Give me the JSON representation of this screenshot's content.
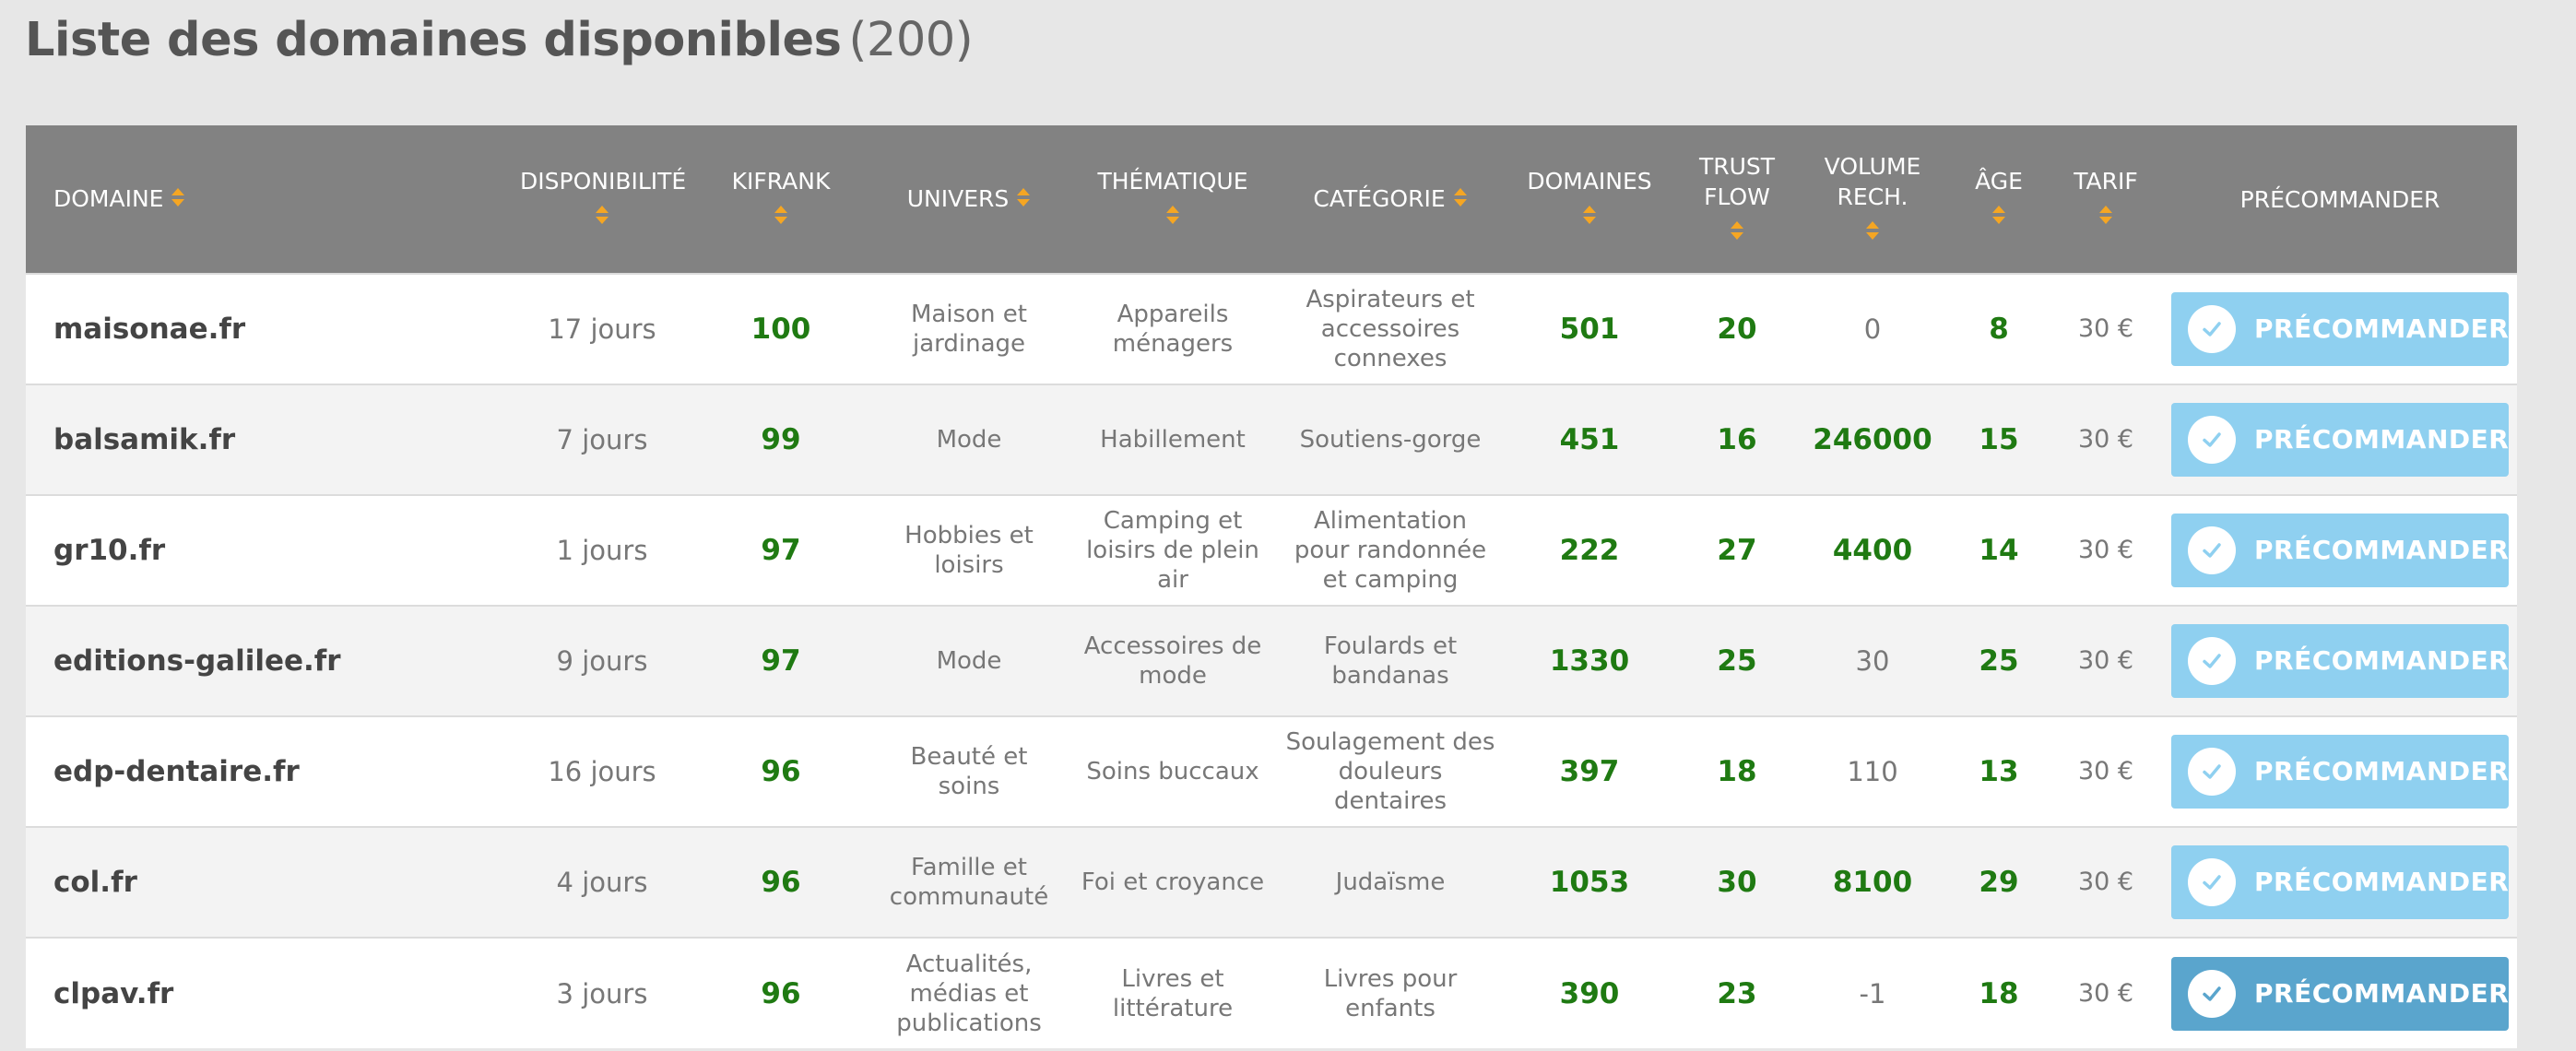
{
  "page": {
    "title": "Liste des domaines disponibles",
    "count": "(200)"
  },
  "colors": {
    "header_bg": "#828282",
    "sort_arrow": "#f5a623",
    "value_green": "#1f7a12",
    "button_bg": "#8fd0f0",
    "button_active_bg": "#5aa5cd"
  },
  "table": {
    "headers": {
      "domaine": "DOMAINE",
      "disponibilite": "DISPONIBILITÉ",
      "kifrank": "KIFRANK",
      "univers": "UNIVERS",
      "thematique": "THÉMATIQUE",
      "categorie": "CATÉGORIE",
      "domaines": "DOMAINES",
      "trust_flow_1": "TRUST",
      "trust_flow_2": "FLOW",
      "volume_1": "VOLUME",
      "volume_2": "RECH.",
      "age": "ÂGE",
      "tarif": "TARIF",
      "precommander": "PRÉCOMMANDER"
    },
    "button_label": "PRÉCOMMANDER",
    "icons": {
      "sort": "sort-arrows-icon",
      "check": "check-circle-icon"
    },
    "rows": [
      {
        "domain": "maisonae.fr",
        "availability": "17 jours",
        "kifrank": "100",
        "univers": "Maison et jardinage",
        "thematique": "Appareils ménagers",
        "categorie": "Aspirateurs et accessoires connexes",
        "domaines": "501",
        "trust_flow": "20",
        "volume": "0",
        "age": "8",
        "tarif": "30 €"
      },
      {
        "domain": "balsamik.fr",
        "availability": "7 jours",
        "kifrank": "99",
        "univers": "Mode",
        "thematique": "Habillement",
        "categorie": "Soutiens-gorge",
        "domaines": "451",
        "trust_flow": "16",
        "volume": "246000",
        "age": "15",
        "tarif": "30 €"
      },
      {
        "domain": "gr10.fr",
        "availability": "1 jours",
        "kifrank": "97",
        "univers": "Hobbies et loisirs",
        "thematique": "Camping et loisirs de plein air",
        "categorie": "Alimentation pour randonnée et camping",
        "domaines": "222",
        "trust_flow": "27",
        "volume": "4400",
        "age": "14",
        "tarif": "30 €"
      },
      {
        "domain": "editions-galilee.fr",
        "availability": "9 jours",
        "kifrank": "97",
        "univers": "Mode",
        "thematique": "Accessoires de mode",
        "categorie": "Foulards et bandanas",
        "domaines": "1330",
        "trust_flow": "25",
        "volume": "30",
        "age": "25",
        "tarif": "30 €"
      },
      {
        "domain": "edp-dentaire.fr",
        "availability": "16 jours",
        "kifrank": "96",
        "univers": "Beauté et soins",
        "thematique": "Soins buccaux",
        "categorie": "Soulagement des douleurs dentaires",
        "domaines": "397",
        "trust_flow": "18",
        "volume": "110",
        "age": "13",
        "tarif": "30 €"
      },
      {
        "domain": "col.fr",
        "availability": "4 jours",
        "kifrank": "96",
        "univers": "Famille et communauté",
        "thematique": "Foi et croyance",
        "categorie": "Judaïsme",
        "domaines": "1053",
        "trust_flow": "30",
        "volume": "8100",
        "age": "29",
        "tarif": "30 €"
      },
      {
        "domain": "clpav.fr",
        "availability": "3 jours",
        "kifrank": "96",
        "univers": "Actualités, médias et publications",
        "thematique": "Livres et littérature",
        "categorie": "Livres pour enfants",
        "domaines": "390",
        "trust_flow": "23",
        "volume": "-1",
        "age": "18",
        "tarif": "30 €"
      }
    ]
  }
}
